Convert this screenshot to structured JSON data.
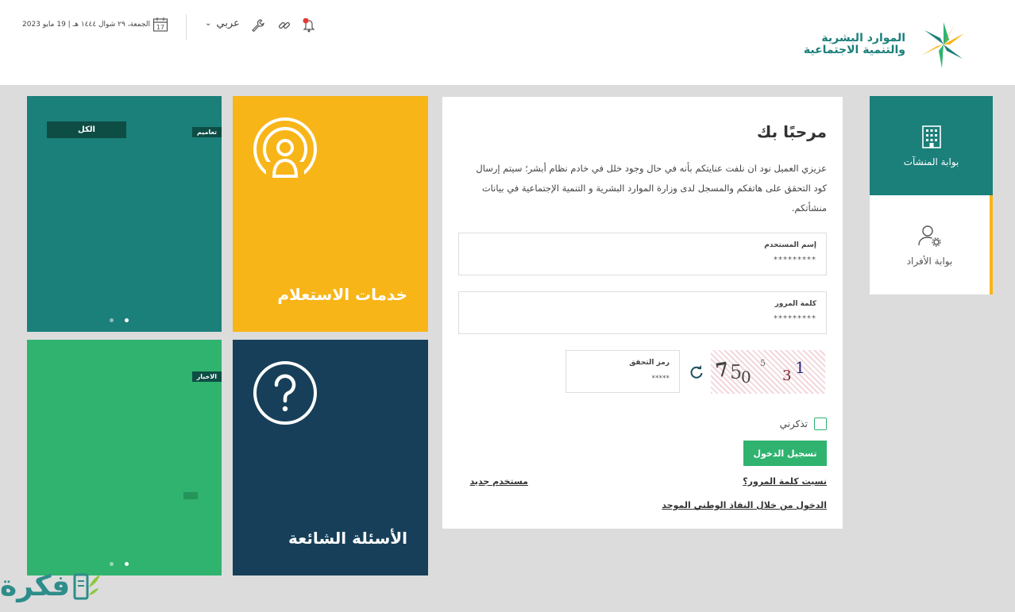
{
  "header": {
    "logo_line1": "الموارد البشرية",
    "logo_line2": "والتنمية الاجتماعية",
    "date": "الجمعة، ٢٩ شوال ١٤٤٤ هـ | 19 مايو 2023",
    "calendar_day": "17",
    "language": "عربي"
  },
  "side_nav": {
    "establishments": "بوابة المنشآت",
    "individuals": "بوابة الأفراد"
  },
  "login": {
    "title": "مرحبًا بك",
    "description": "عزيزي العميل نود ان نلفت عنايتكم بأنه في حال وجود خلل في خادم نظام أبشر؛ سيتم إرسال كود التحقق على هاتفكم والمسجل لدى وزارة الموارد البشرية و التنمية الإجتماعية في بيانات منشأتكم.",
    "username_label": "إسم المستخدم",
    "username_value": "*********",
    "password_label": "كلمة المرور",
    "password_value": "*********",
    "captcha_label": "رمز التحقق",
    "captcha_value": "*****",
    "captcha_chars": [
      "7",
      "5",
      "0",
      "5",
      "3",
      "1"
    ],
    "remember_me": "تذكرني",
    "login_button": "تسجيل الدخول",
    "forgot_password": "نسيت كلمة المرور؟",
    "new_user": "مستخدم جديد",
    "nafath_link": "الدخول من خلال النفاذ الوطني الموحد"
  },
  "tiles": {
    "inquiry": "خدمات الاستعلام",
    "faq": "الأسئلة الشائعة",
    "circulars_badge": "تعاميم",
    "all_button": "الكل",
    "news_badge": "الاخبار"
  },
  "watermark": "فكرة",
  "colors": {
    "teal": "#1b7f7a",
    "yellow": "#f8b518",
    "green": "#2fb36f",
    "navy": "#173f59"
  }
}
